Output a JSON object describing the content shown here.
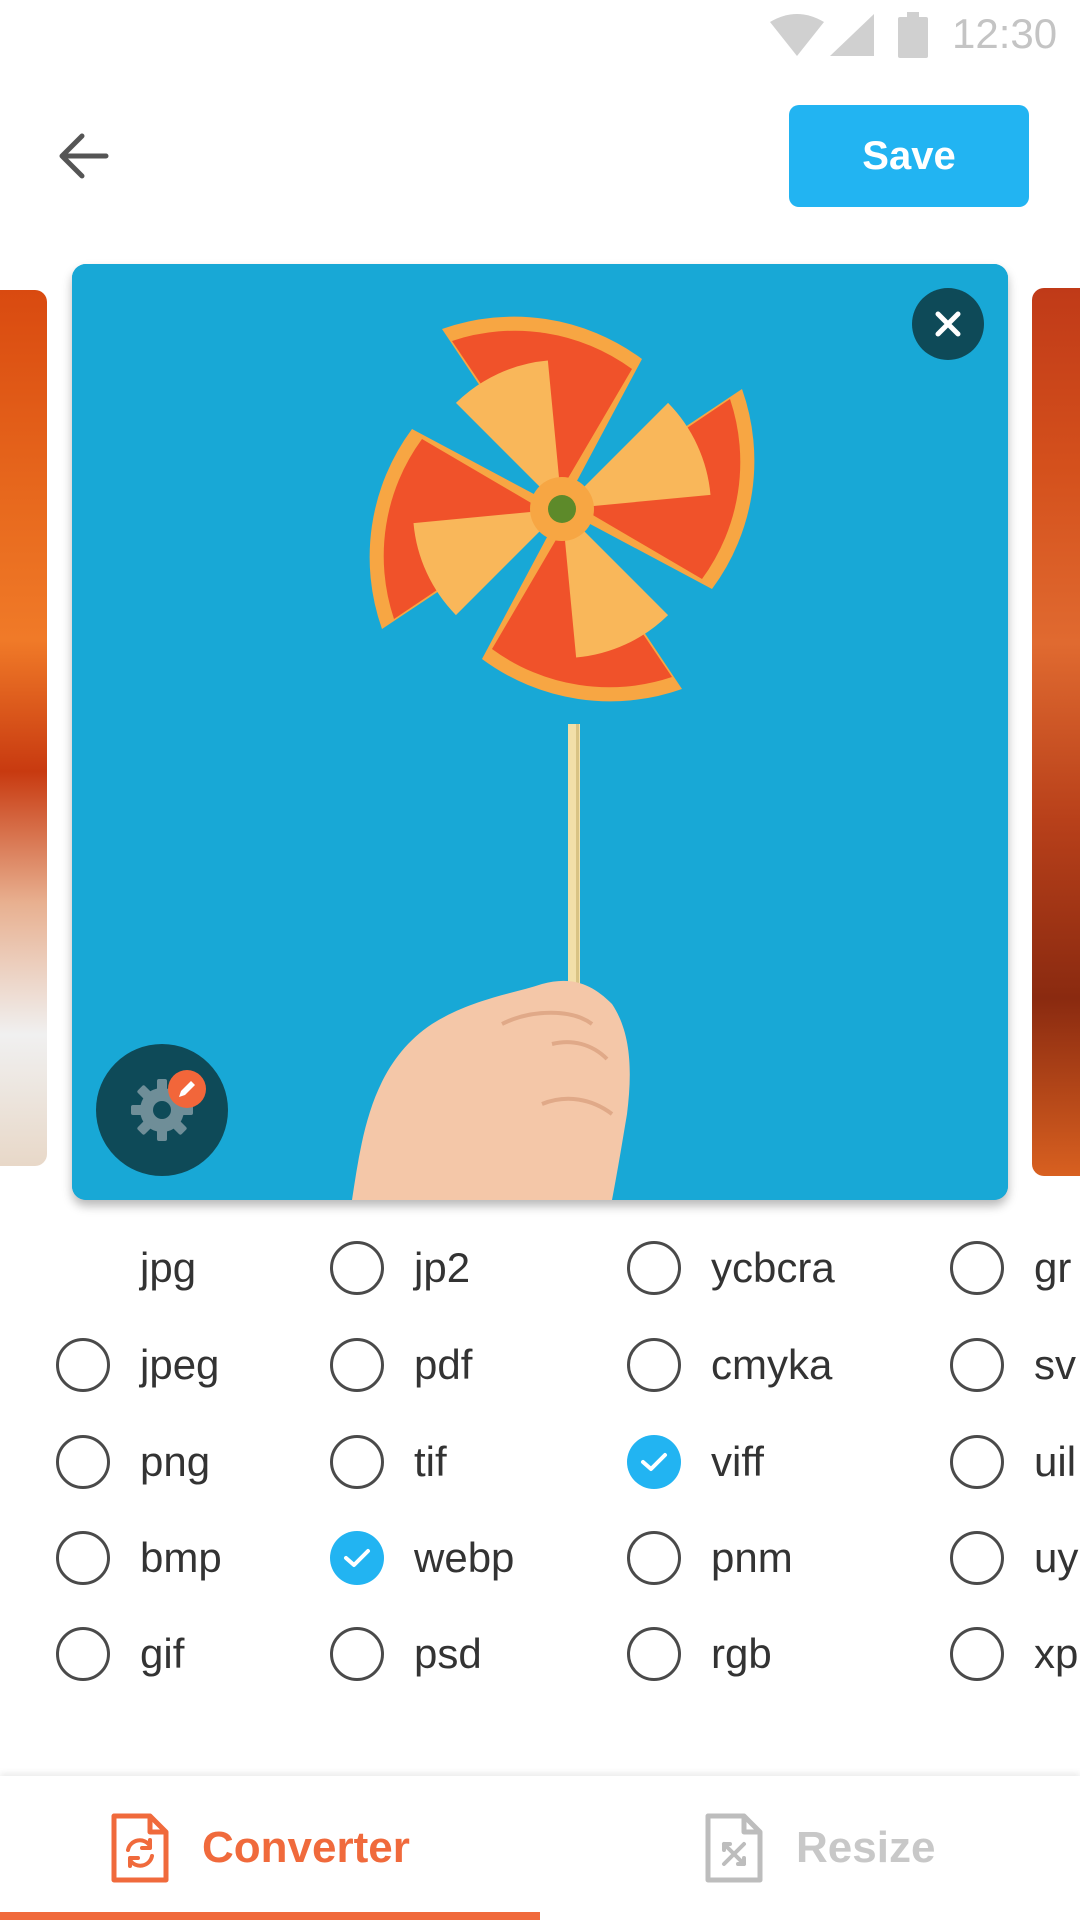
{
  "status_bar": {
    "time": "12:30",
    "icons": [
      "wifi-icon",
      "signal-icon",
      "battery-icon"
    ]
  },
  "header": {
    "back_icon": "arrow-left-icon",
    "save_label": "Save"
  },
  "carousel": {
    "close_icon": "close-icon",
    "settings_icon": "gear-icon",
    "settings_badge_icon": "pencil-icon"
  },
  "formats": {
    "col1": [
      {
        "label": "jpg",
        "radio": false,
        "checked": false
      },
      {
        "label": "jpeg",
        "radio": true,
        "checked": false
      },
      {
        "label": "png",
        "radio": true,
        "checked": false
      },
      {
        "label": "bmp",
        "radio": true,
        "checked": false
      },
      {
        "label": "gif",
        "radio": true,
        "checked": false
      }
    ],
    "col2": [
      {
        "label": "jp2",
        "radio": true,
        "checked": false
      },
      {
        "label": "pdf",
        "radio": true,
        "checked": false
      },
      {
        "label": "tif",
        "radio": true,
        "checked": false
      },
      {
        "label": "webp",
        "radio": true,
        "checked": true
      },
      {
        "label": "psd",
        "radio": true,
        "checked": false
      }
    ],
    "col3": [
      {
        "label": "ycbcra",
        "radio": true,
        "checked": false
      },
      {
        "label": "cmyka",
        "radio": true,
        "checked": false
      },
      {
        "label": "viff",
        "radio": true,
        "checked": true
      },
      {
        "label": "pnm",
        "radio": true,
        "checked": false
      },
      {
        "label": "rgb",
        "radio": true,
        "checked": false
      }
    ],
    "col4": [
      {
        "label": "gr",
        "radio": true,
        "checked": false
      },
      {
        "label": "sv",
        "radio": true,
        "checked": false
      },
      {
        "label": "uil",
        "radio": true,
        "checked": false
      },
      {
        "label": "uy",
        "radio": true,
        "checked": false
      },
      {
        "label": "xp",
        "radio": true,
        "checked": false
      }
    ]
  },
  "bottom_nav": {
    "converter_label": "Converter",
    "converter_icon": "file-convert-icon",
    "resize_label": "Resize",
    "resize_icon": "file-resize-icon",
    "active": "Converter"
  },
  "colors": {
    "accent_blue": "#22b4f2",
    "accent_orange": "#f06a3c",
    "dark_teal": "#0e4a58"
  }
}
